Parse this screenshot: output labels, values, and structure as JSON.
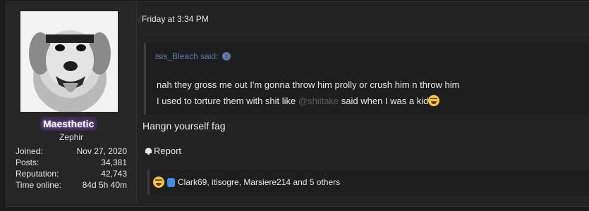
{
  "user": {
    "name": "Maesthetic",
    "title": "Zephir",
    "stats": [
      {
        "label": "Joined:",
        "value": "Nov 27, 2020"
      },
      {
        "label": "Posts:",
        "value": "34,381"
      },
      {
        "label": "Reputation:",
        "value": "42,743"
      },
      {
        "label": "Time online:",
        "value": "84d 5h 40m"
      }
    ]
  },
  "post": {
    "date": "Friday at 3:34 PM",
    "quote": {
      "author": "isis_Bleach said:",
      "line1": "nah they gross me out I'm gonna throw him prolly or crush him n throw him",
      "line2_before": "I used to torture them with shit like ",
      "line2_mention": "@shiitake",
      "line2_after": " said when I was a kid"
    },
    "message": "Hangn yourself fag",
    "report_label": "Report",
    "reactions_text": "Clark69, itisogre, Marsiere214 and 5 others"
  },
  "icons": {
    "quote_up": "arrow-up-circle-icon",
    "report": "bell-icon",
    "laugh": "laughing-emoji-icon",
    "like": "thumbs-up-icon"
  },
  "colors": {
    "background": "#1b1b1b",
    "post_bg": "#232323",
    "quote_link": "#5d79a8",
    "username_glow": "#b08cff"
  }
}
